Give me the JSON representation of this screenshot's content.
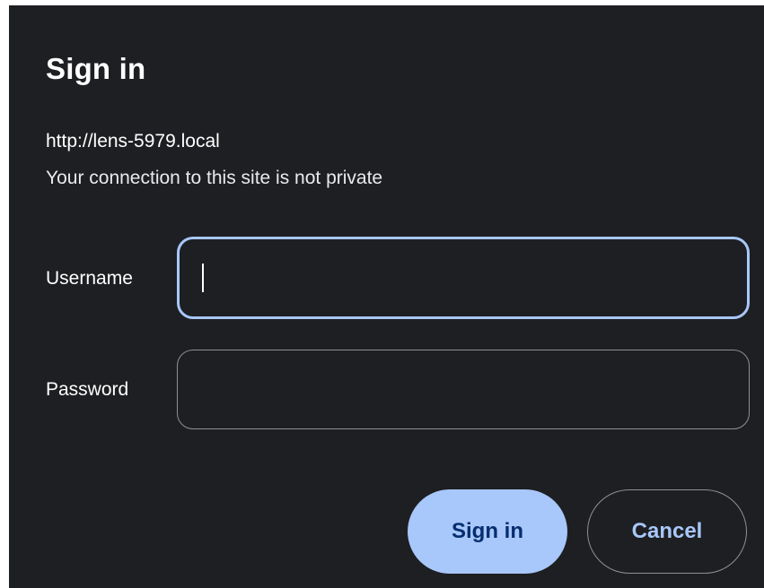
{
  "dialog": {
    "title": "Sign in",
    "origin": "http://lens-5979.local",
    "warning": "Your connection to this site is not private",
    "username_label": "Username",
    "username_value": "",
    "password_label": "Password",
    "password_value": "",
    "signin_label": "Sign in",
    "cancel_label": "Cancel"
  },
  "colors": {
    "dialog_background": "#1e1f22",
    "accent": "#a8c7fa",
    "outline": "#8e918f"
  }
}
